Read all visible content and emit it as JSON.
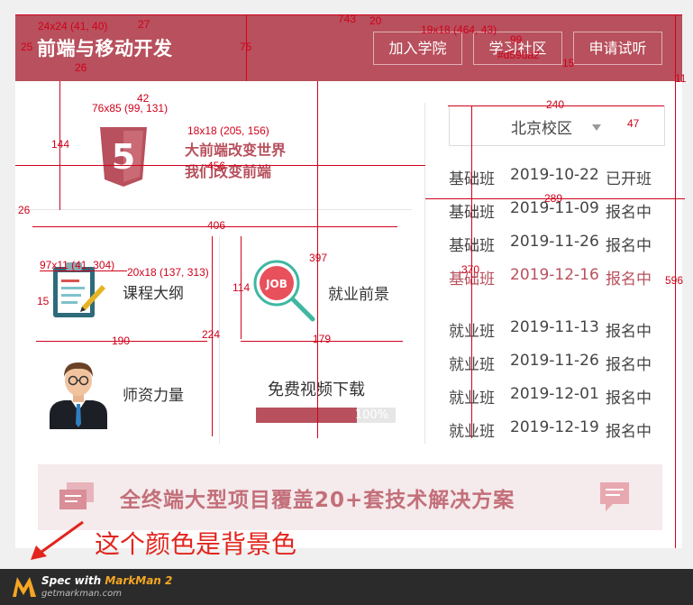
{
  "header": {
    "title": "前端与移动开发",
    "nav": [
      "加入学院",
      "学习社区",
      "申请试听"
    ]
  },
  "hero": {
    "logo_text": "5",
    "slogan_line1": "大前端改变世界",
    "slogan_line2": "我们改变前端"
  },
  "tiles": {
    "syllabus": "课程大纲",
    "jobs": "就业前景",
    "jobs_badge": "JOB",
    "teachers": "师资力量",
    "download": "免费视频下载"
  },
  "progress": {
    "value": 0.72,
    "label": "100%"
  },
  "campus": {
    "selected": "北京校区"
  },
  "schedule": [
    {
      "type": "基础班",
      "date": "2019-10-22",
      "status": "已开班",
      "highlight": false
    },
    {
      "type": "基础班",
      "date": "2019-11-09",
      "status": "报名中",
      "highlight": false
    },
    {
      "type": "基础班",
      "date": "2019-11-26",
      "status": "报名中",
      "highlight": false
    },
    {
      "type": "基础班",
      "date": "2019-12-16",
      "status": "报名中",
      "highlight": true
    },
    {
      "type": "就业班",
      "date": "2019-11-13",
      "status": "报名中",
      "highlight": false
    },
    {
      "type": "就业班",
      "date": "2019-11-26",
      "status": "报名中",
      "highlight": false
    },
    {
      "type": "就业班",
      "date": "2019-12-01",
      "status": "报名中",
      "highlight": false
    },
    {
      "type": "就业班",
      "date": "2019-12-19",
      "status": "报名中",
      "highlight": false
    }
  ],
  "banner": {
    "text": "全终端大型项目覆盖20+套技术解决方案"
  },
  "note": "这个颜色是背景色",
  "footer": {
    "title_prefix": "Spec with ",
    "title_brand": "MarkMan 2",
    "sub": "getmarkman.com"
  },
  "colors": {
    "brand": "#b8505d",
    "page_bg": "#f0f0f0",
    "nav_text": "#ffffff",
    "note_red": "#e2251d"
  },
  "spec": {
    "s743": "743",
    "s20": "20",
    "s27": "27",
    "s24": "24x24 (41, 40)",
    "s25": "25",
    "s26": "26",
    "s75": "75",
    "s19": "19x18 (464, 43)",
    "s99": "99",
    "s15a": "15",
    "s11": "11",
    "scolor": "#d59da2",
    "s42": "42",
    "s76": "76x85 (99, 131)",
    "s18": "18x18 (205, 156)",
    "s144": "144",
    "s456": "456",
    "s47": "47",
    "s240": "240",
    "s26b": "26",
    "s289": "289",
    "s406": "406",
    "s97": "97x11 (41, 304)",
    "s20b": "20x18 (137, 313)",
    "s15b": "15",
    "s397": "397",
    "s114": "114",
    "s370": "370",
    "s596": "596",
    "s190": "190",
    "s224": "224",
    "s179": "179"
  }
}
